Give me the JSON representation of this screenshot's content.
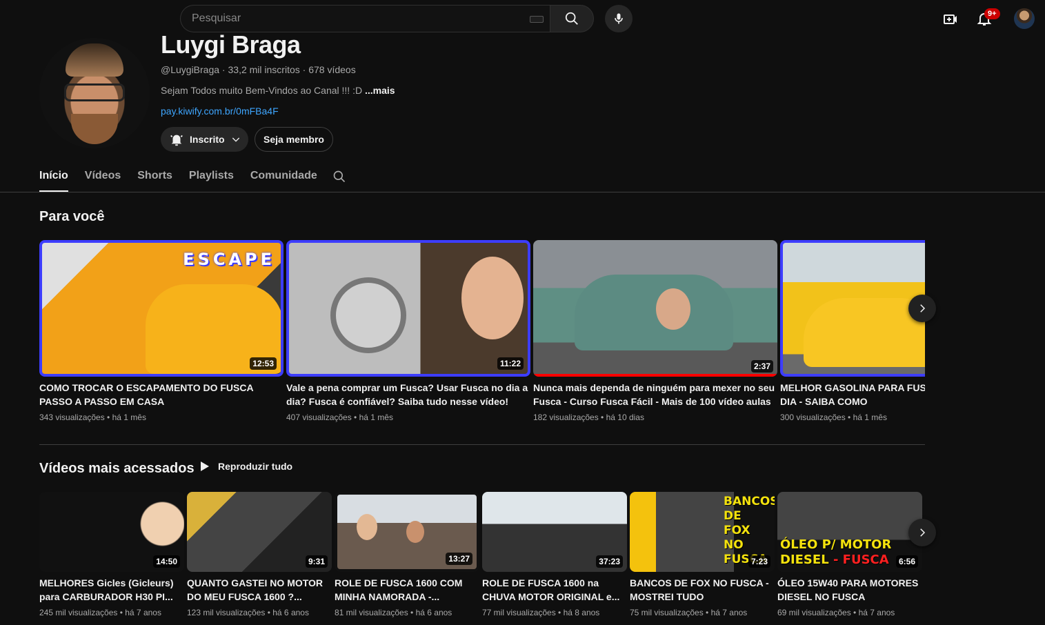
{
  "search": {
    "placeholder": "Pesquisar"
  },
  "notifications": {
    "badge": "9+"
  },
  "channel": {
    "name": "Luygi Braga",
    "handle": "@LuygiBraga",
    "subscribers": "33,2 mil inscritos",
    "videos": "678 vídeos",
    "meta_separator": " · ",
    "description": "Sejam Todos muito Bem-Vindos ao Canal !!!  :D ",
    "description_more": "...mais",
    "link": "pay.kiwify.com.br/0mFBa4F",
    "subscribed_label": "Inscrito",
    "member_label": "Seja membro"
  },
  "tabs": [
    {
      "label": "Início",
      "active": true
    },
    {
      "label": "Vídeos"
    },
    {
      "label": "Shorts"
    },
    {
      "label": "Playlists"
    },
    {
      "label": "Comunidade"
    }
  ],
  "sections": {
    "for_you": {
      "title": "Para você",
      "videos": [
        {
          "title": "COMO TROCAR O ESCAPAMENTO DO FUSCA PASSO A PASSO EM CASA",
          "meta": "343 visualizações • há 1 mês",
          "duration": "12:53",
          "overlay": "ESCAPE"
        },
        {
          "title": "Vale a pena comprar um Fusca? Usar Fusca no dia a dia? Fusca é confiável? Saiba tudo nesse vídeo!",
          "meta": "407 visualizações • há 1 mês",
          "duration": "11:22"
        },
        {
          "title": "Nunca mais dependa de ninguém para mexer no seu Fusca - Curso Fusca Fácil - Mais de 100 vídeo aulas",
          "meta": "182 visualizações • há 10 dias",
          "duration": "2:37",
          "watched_fraction": 1.0
        },
        {
          "title": "MELHOR GASOLINA PARA FUSCA FUSCA DO DIA A DIA - SAIBA COMO",
          "meta": "300 visualizações • há 1 mês",
          "duration": ""
        }
      ]
    },
    "most_viewed": {
      "title": "Vídeos mais acessados",
      "play_all": "Reproduzir tudo",
      "videos": [
        {
          "title": "MELHORES Gicles (Gicleurs) para CARBURADOR H30 PI...",
          "meta": "245 mil visualizações • há 7 anos",
          "duration": "14:50"
        },
        {
          "title": "QUANTO GASTEI NO MOTOR DO MEU FUSCA 1600 ?...",
          "meta": "123 mil visualizações • há 6 anos",
          "duration": "9:31"
        },
        {
          "title": "ROLE DE FUSCA 1600 COM MINHA NAMORADA -...",
          "meta": "81 mil visualizações • há 6 anos",
          "duration": "13:27"
        },
        {
          "title": "ROLE DE FUSCA 1600 na CHUVA MOTOR ORIGINAL e...",
          "meta": "77 mil visualizações • há 8 anos",
          "duration": "37:23"
        },
        {
          "title": "BANCOS DE FOX NO FUSCA - MOSTREI TUDO",
          "meta": "75 mil visualizações • há 7 anos",
          "duration": "7:23",
          "overlay": "BANCOS DE FOX NO FUSCA"
        },
        {
          "title": "ÓLEO 15W40 PARA MOTORES DIESEL NO FUSCA",
          "meta": "69 mil visualizações • há 7 anos",
          "duration": "6:56",
          "overlay_1": "ÓLEO P/ MOTOR",
          "overlay_2": "DIESEL",
          "overlay_3": " - FUSCA"
        }
      ]
    }
  },
  "colors": {
    "background": "#0f0f0f",
    "link": "#3ea6ff",
    "accent_red": "#ff0000",
    "thumb_border": "#3d3dff"
  },
  "icons": [
    "keyboard-icon",
    "search-icon",
    "mic-icon",
    "create-icon",
    "bell-icon",
    "bell-subscribed-icon",
    "chevron-down-icon",
    "play-icon",
    "chevron-right-icon"
  ]
}
